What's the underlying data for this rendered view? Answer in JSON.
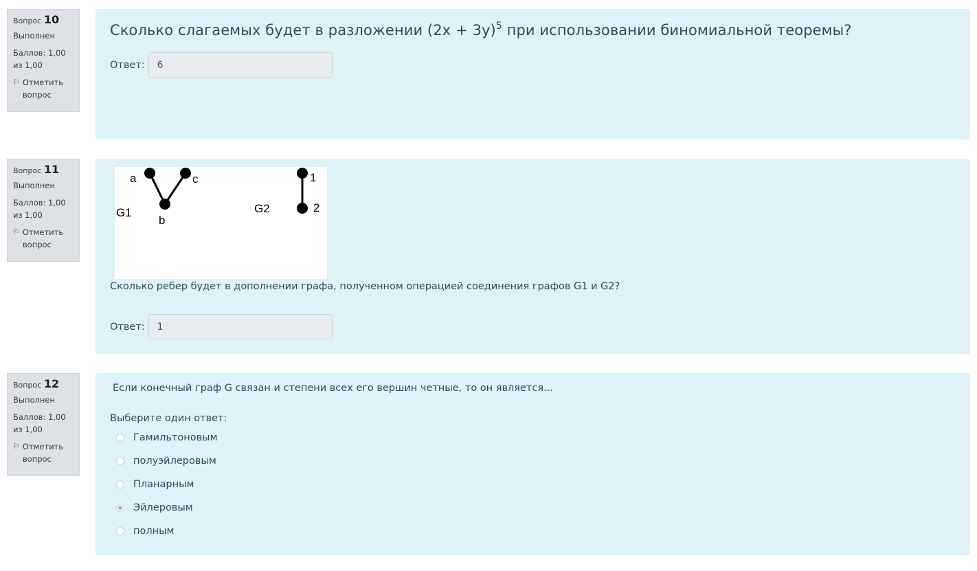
{
  "questions": [
    {
      "label": "Вопрос",
      "number": "10",
      "state": "Выполнен",
      "grade": "Баллов: 1,00 из 1,00",
      "flag": "Отметить вопрос",
      "text_before": "Сколько слагаемых будет в разложении (2x + 3y)",
      "text_sup": "5",
      "text_after": " при использовании биномиальной теоремы?",
      "answer_label": "Ответ:",
      "answer_value": "6"
    },
    {
      "label": "Вопрос",
      "number": "11",
      "state": "Выполнен",
      "grade": "Баллов: 1,00 из 1,00",
      "flag": "Отметить вопрос",
      "graph": {
        "g1_label": "G1",
        "g2_label": "G2",
        "vertices_g1": [
          "a",
          "b",
          "c"
        ],
        "vertices_g2": [
          "1",
          "2"
        ]
      },
      "text": "Сколько ребер будет в дополнении графа, полученном операцией соединения графов G1 и G2?",
      "answer_label": "Ответ:",
      "answer_value": "1"
    },
    {
      "label": "Вопрос",
      "number": "12",
      "state": "Выполнен",
      "grade": "Баллов: 1,00 из 1,00",
      "flag": "Отметить вопрос",
      "text": "Если конечный граф G связан и степени всех его вершин четные, то он является...",
      "prompt": "Выберите один ответ:",
      "options": [
        "Гамильтоновым",
        "полуэйлеровым",
        "Планарным",
        "Эйлеровым",
        "полным"
      ],
      "selected_option": "Эйлеровым"
    }
  ]
}
